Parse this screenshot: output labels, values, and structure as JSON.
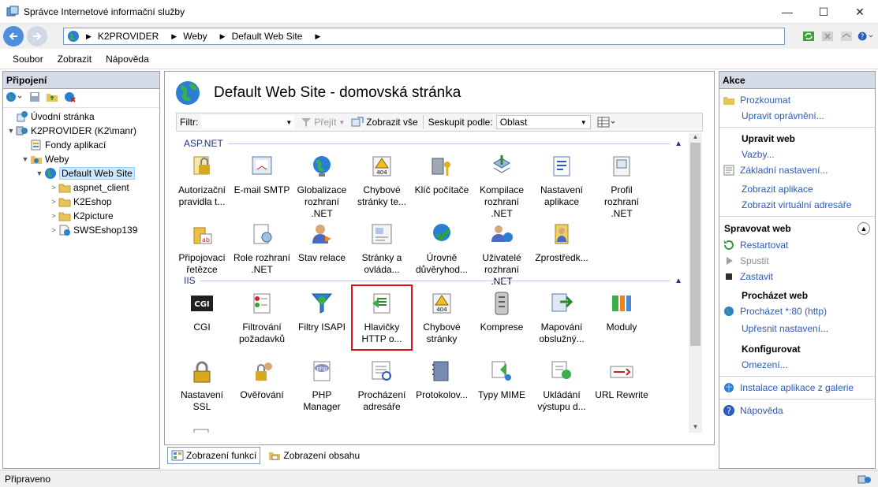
{
  "window": {
    "title": "Správce Internetové informační služby",
    "minimize": "—",
    "maximize": "☐",
    "close": "✕"
  },
  "address": {
    "crumbs": [
      "K2PROVIDER",
      "Weby",
      "Default Web Site"
    ]
  },
  "menu": [
    "Soubor",
    "Zobrazit",
    "Nápověda"
  ],
  "left": {
    "header": "Připojení",
    "tree": [
      {
        "label": "Úvodní stránka",
        "icon": "home-icon",
        "indent": 0,
        "expander": ""
      },
      {
        "label": "K2PROVIDER (K2\\manr)",
        "icon": "server-icon",
        "indent": 0,
        "expander": "▼"
      },
      {
        "label": "Fondy aplikací",
        "icon": "app-pools-icon",
        "indent": 1,
        "expander": ""
      },
      {
        "label": "Weby",
        "icon": "sites-folder-icon",
        "indent": 1,
        "expander": "▼"
      },
      {
        "label": "Default Web Site",
        "icon": "globe-icon",
        "indent": 2,
        "expander": "▼",
        "selected": true
      },
      {
        "label": "aspnet_client",
        "icon": "folder-icon",
        "indent": 3,
        "expander": ">"
      },
      {
        "label": "K2Eshop",
        "icon": "folder-icon",
        "indent": 3,
        "expander": ">"
      },
      {
        "label": "K2picture",
        "icon": "folder-icon",
        "indent": 3,
        "expander": ">"
      },
      {
        "label": "SWSEshop139",
        "icon": "virtual-dir-icon",
        "indent": 3,
        "expander": ">"
      }
    ]
  },
  "center": {
    "title": "Default Web Site - domovská stránka",
    "filter_label": "Filtr:",
    "go_label": "Přejít",
    "show_all_label": "Zobrazit vše",
    "group_by_label": "Seskupit podle:",
    "group_by_value": "Oblast",
    "sections": [
      {
        "name": "ASP.NET",
        "tiles": [
          [
            "Autorizační",
            "pravidla t..."
          ],
          [
            "E-mail SMTP"
          ],
          [
            "Globalizace",
            "rozhraní .NET"
          ],
          [
            "Chybové",
            "stránky te..."
          ],
          [
            "Klíč počítače"
          ],
          [
            "Kompilace",
            "rozhraní .NET"
          ],
          [
            "Nastavení",
            "aplikace"
          ],
          [
            "Profil",
            "rozhraní .NET"
          ],
          [
            "Připojovací",
            "řetězce"
          ],
          [
            "Role rozhraní",
            ".NET"
          ],
          [
            "Stav relace"
          ],
          [
            "Stránky a",
            "ovláda..."
          ],
          [
            "Úrovně",
            "důvěryhod..."
          ],
          [
            "Uživatelé",
            "rozhraní .NET"
          ],
          [
            "Zprostředk..."
          ]
        ]
      },
      {
        "name": "IIS",
        "tiles": [
          [
            "CGI"
          ],
          [
            "Filtrování",
            "požadavků"
          ],
          [
            "Filtry ISAPI"
          ],
          [
            "Hlavičky",
            "HTTP o..."
          ],
          [
            "Chybové",
            "stránky"
          ],
          [
            "Komprese"
          ],
          [
            "Mapování",
            "obslužný..."
          ],
          [
            "Moduly"
          ],
          [
            "Nastavení",
            "SSL"
          ],
          [
            "Ověřování"
          ],
          [
            "PHP",
            "Manager"
          ],
          [
            "Procházení",
            "adresáře"
          ],
          [
            "Protokolov..."
          ],
          [
            "Typy MIME"
          ],
          [
            "Ukládání",
            "výstupu d..."
          ],
          [
            "URL Rewrite"
          ],
          [
            ""
          ]
        ]
      }
    ],
    "tabs": [
      "Zobrazení funkcí",
      "Zobrazení obsahu"
    ]
  },
  "right": {
    "header": "Akce",
    "explore": "Prozkoumat",
    "edit_permissions": "Upravit oprávnění...",
    "edit_site": "Upravit web",
    "bindings": "Vazby...",
    "basic_settings": "Základní nastavení...",
    "view_apps": "Zobrazit aplikace",
    "view_vdirs": "Zobrazit virtuální adresáře",
    "manage_site": "Spravovat web",
    "restart": "Restartovat",
    "start": "Spustit",
    "stop": "Zastavit",
    "browse_site": "Procházet web",
    "browse_port": "Procházet *:80 (http)",
    "advanced_settings": "Upřesnit nastavení...",
    "configure": "Konfigurovat",
    "limits": "Omezení...",
    "install_gallery": "Instalace aplikace z galerie",
    "help": "Nápověda"
  },
  "status": {
    "text": "Připraveno"
  }
}
